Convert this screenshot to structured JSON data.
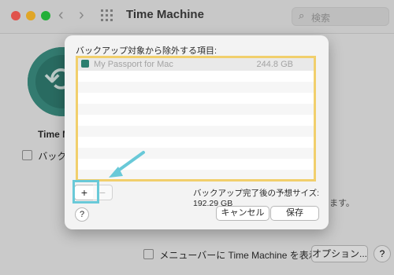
{
  "window": {
    "title": "Time Machine",
    "search_placeholder": "検索",
    "app_label": "Time M",
    "backup_auto_label": "バックア",
    "note_fragment": "ます。",
    "menu_bar_option_label": "メニューバーに Time Machine を表示",
    "options_button": "オプション...",
    "help_label": "?"
  },
  "sheet": {
    "title": "バックアップ対象から除外する項目:",
    "rows": [
      {
        "name": "My Passport for Mac",
        "size": "244.8 GB"
      }
    ],
    "plus_label": "+",
    "minus_label": "−",
    "estimate_text": "バックアップ完了後の予想サイズ: 192.29 GB",
    "cancel_button": "キャンセル",
    "save_button": "保存",
    "help_label": "?"
  },
  "colors": {
    "highlight_box": "#69c9d8",
    "list_border": "#f1cf6c"
  }
}
